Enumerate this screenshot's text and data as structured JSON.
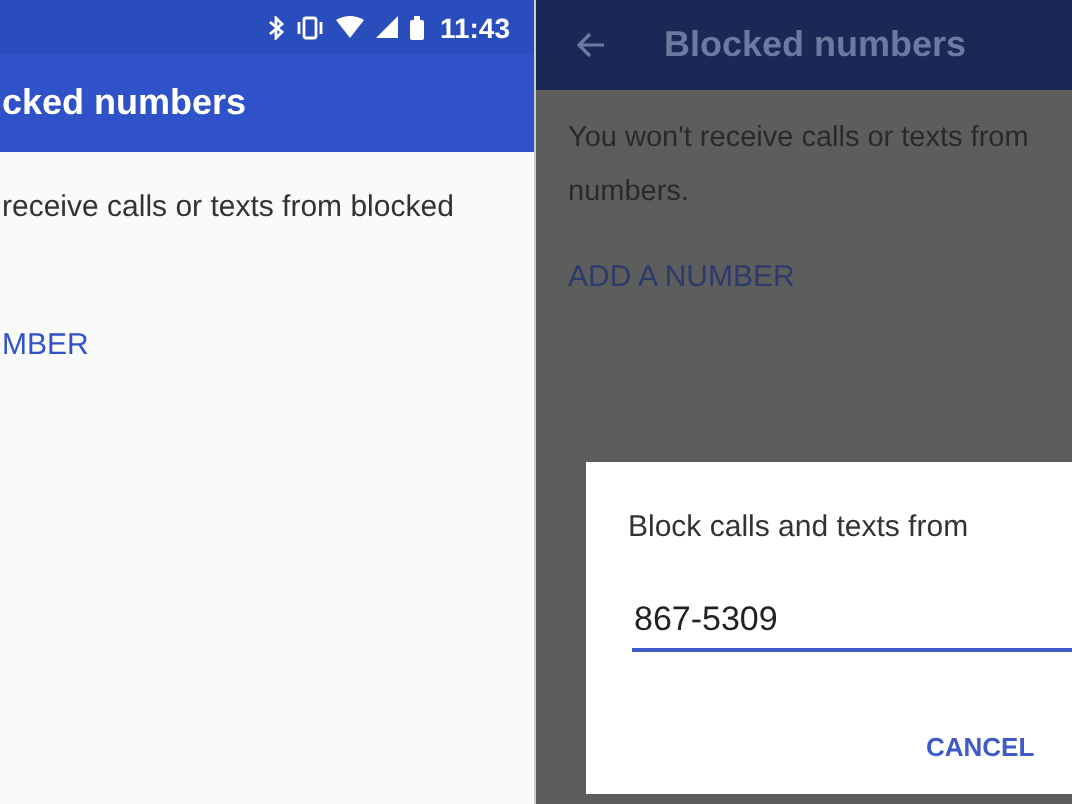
{
  "left_screen": {
    "status_bar": {
      "time": "11:43"
    },
    "app_bar": {
      "title": "cked numbers"
    },
    "message": "receive calls or texts from blocked",
    "add_link": "MBER"
  },
  "right_screen": {
    "app_bar": {
      "title": "Blocked numbers"
    },
    "message_lines": [
      "You won't receive calls or texts from",
      "numbers."
    ],
    "add_link": "ADD A NUMBER",
    "dialog": {
      "title": "Block calls and texts from",
      "input": {
        "value": "867-5309"
      },
      "buttons": [
        "CANCEL"
      ]
    }
  }
}
